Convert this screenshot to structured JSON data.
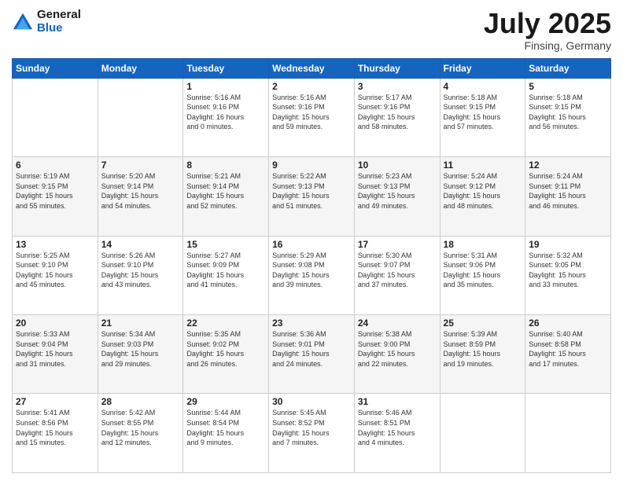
{
  "header": {
    "logo_line1": "General",
    "logo_line2": "Blue",
    "month_year": "July 2025",
    "location": "Finsing, Germany"
  },
  "days_of_week": [
    "Sunday",
    "Monday",
    "Tuesday",
    "Wednesday",
    "Thursday",
    "Friday",
    "Saturday"
  ],
  "weeks": [
    [
      {
        "day": "",
        "info": ""
      },
      {
        "day": "",
        "info": ""
      },
      {
        "day": "1",
        "info": "Sunrise: 5:16 AM\nSunset: 9:16 PM\nDaylight: 16 hours\nand 0 minutes."
      },
      {
        "day": "2",
        "info": "Sunrise: 5:16 AM\nSunset: 9:16 PM\nDaylight: 15 hours\nand 59 minutes."
      },
      {
        "day": "3",
        "info": "Sunrise: 5:17 AM\nSunset: 9:16 PM\nDaylight: 15 hours\nand 58 minutes."
      },
      {
        "day": "4",
        "info": "Sunrise: 5:18 AM\nSunset: 9:15 PM\nDaylight: 15 hours\nand 57 minutes."
      },
      {
        "day": "5",
        "info": "Sunrise: 5:18 AM\nSunset: 9:15 PM\nDaylight: 15 hours\nand 56 minutes."
      }
    ],
    [
      {
        "day": "6",
        "info": "Sunrise: 5:19 AM\nSunset: 9:15 PM\nDaylight: 15 hours\nand 55 minutes."
      },
      {
        "day": "7",
        "info": "Sunrise: 5:20 AM\nSunset: 9:14 PM\nDaylight: 15 hours\nand 54 minutes."
      },
      {
        "day": "8",
        "info": "Sunrise: 5:21 AM\nSunset: 9:14 PM\nDaylight: 15 hours\nand 52 minutes."
      },
      {
        "day": "9",
        "info": "Sunrise: 5:22 AM\nSunset: 9:13 PM\nDaylight: 15 hours\nand 51 minutes."
      },
      {
        "day": "10",
        "info": "Sunrise: 5:23 AM\nSunset: 9:13 PM\nDaylight: 15 hours\nand 49 minutes."
      },
      {
        "day": "11",
        "info": "Sunrise: 5:24 AM\nSunset: 9:12 PM\nDaylight: 15 hours\nand 48 minutes."
      },
      {
        "day": "12",
        "info": "Sunrise: 5:24 AM\nSunset: 9:11 PM\nDaylight: 15 hours\nand 46 minutes."
      }
    ],
    [
      {
        "day": "13",
        "info": "Sunrise: 5:25 AM\nSunset: 9:10 PM\nDaylight: 15 hours\nand 45 minutes."
      },
      {
        "day": "14",
        "info": "Sunrise: 5:26 AM\nSunset: 9:10 PM\nDaylight: 15 hours\nand 43 minutes."
      },
      {
        "day": "15",
        "info": "Sunrise: 5:27 AM\nSunset: 9:09 PM\nDaylight: 15 hours\nand 41 minutes."
      },
      {
        "day": "16",
        "info": "Sunrise: 5:29 AM\nSunset: 9:08 PM\nDaylight: 15 hours\nand 39 minutes."
      },
      {
        "day": "17",
        "info": "Sunrise: 5:30 AM\nSunset: 9:07 PM\nDaylight: 15 hours\nand 37 minutes."
      },
      {
        "day": "18",
        "info": "Sunrise: 5:31 AM\nSunset: 9:06 PM\nDaylight: 15 hours\nand 35 minutes."
      },
      {
        "day": "19",
        "info": "Sunrise: 5:32 AM\nSunset: 9:05 PM\nDaylight: 15 hours\nand 33 minutes."
      }
    ],
    [
      {
        "day": "20",
        "info": "Sunrise: 5:33 AM\nSunset: 9:04 PM\nDaylight: 15 hours\nand 31 minutes."
      },
      {
        "day": "21",
        "info": "Sunrise: 5:34 AM\nSunset: 9:03 PM\nDaylight: 15 hours\nand 29 minutes."
      },
      {
        "day": "22",
        "info": "Sunrise: 5:35 AM\nSunset: 9:02 PM\nDaylight: 15 hours\nand 26 minutes."
      },
      {
        "day": "23",
        "info": "Sunrise: 5:36 AM\nSunset: 9:01 PM\nDaylight: 15 hours\nand 24 minutes."
      },
      {
        "day": "24",
        "info": "Sunrise: 5:38 AM\nSunset: 9:00 PM\nDaylight: 15 hours\nand 22 minutes."
      },
      {
        "day": "25",
        "info": "Sunrise: 5:39 AM\nSunset: 8:59 PM\nDaylight: 15 hours\nand 19 minutes."
      },
      {
        "day": "26",
        "info": "Sunrise: 5:40 AM\nSunset: 8:58 PM\nDaylight: 15 hours\nand 17 minutes."
      }
    ],
    [
      {
        "day": "27",
        "info": "Sunrise: 5:41 AM\nSunset: 8:56 PM\nDaylight: 15 hours\nand 15 minutes."
      },
      {
        "day": "28",
        "info": "Sunrise: 5:42 AM\nSunset: 8:55 PM\nDaylight: 15 hours\nand 12 minutes."
      },
      {
        "day": "29",
        "info": "Sunrise: 5:44 AM\nSunset: 8:54 PM\nDaylight: 15 hours\nand 9 minutes."
      },
      {
        "day": "30",
        "info": "Sunrise: 5:45 AM\nSunset: 8:52 PM\nDaylight: 15 hours\nand 7 minutes."
      },
      {
        "day": "31",
        "info": "Sunrise: 5:46 AM\nSunset: 8:51 PM\nDaylight: 15 hours\nand 4 minutes."
      },
      {
        "day": "",
        "info": ""
      },
      {
        "day": "",
        "info": ""
      }
    ]
  ]
}
